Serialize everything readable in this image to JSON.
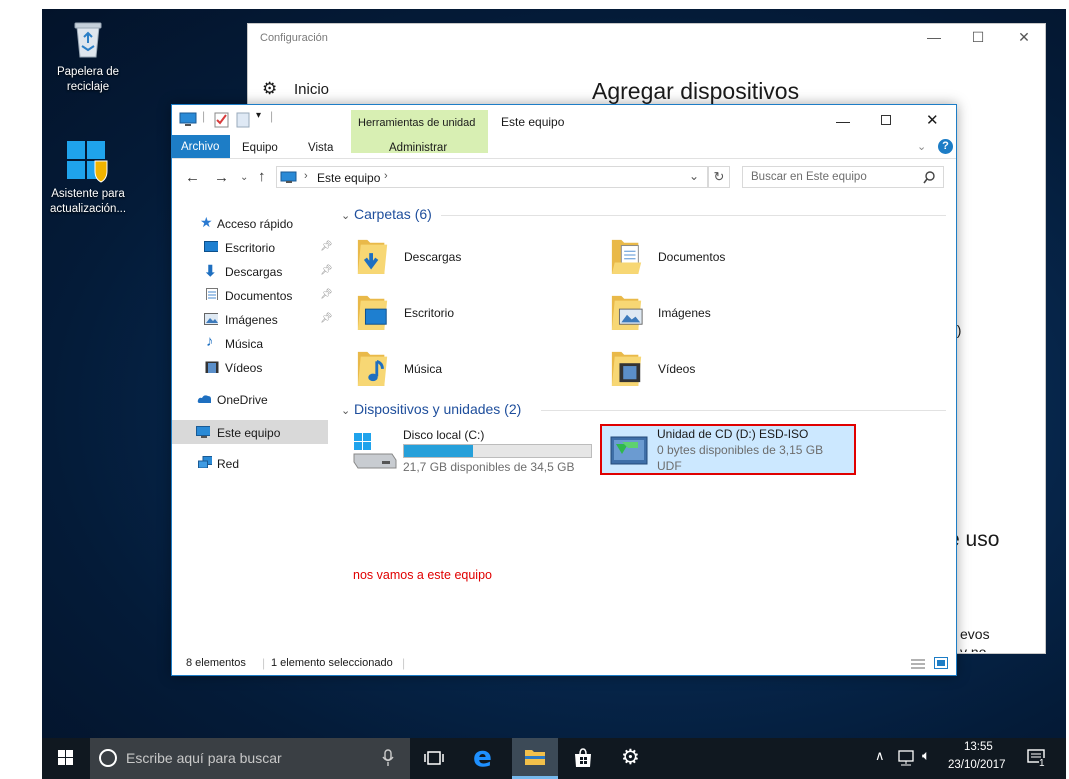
{
  "desktop": {
    "icons": [
      {
        "label_line1": "Papelera de",
        "label_line2": "reciclaje",
        "icon": "recycle-bin-icon"
      },
      {
        "label_line1": "Asistente para",
        "label_line2": "actualización...",
        "icon": "windows-update-assistant-icon"
      }
    ]
  },
  "settings_window": {
    "title": "Configuración",
    "nav_home": "Inicio",
    "heading": "Agregar dispositivos",
    "fragments": [
      ")",
      "o)",
      "e uso",
      "n",
      "evos",
      "v no"
    ],
    "controls": {
      "minimize": "—",
      "maximize": "☐",
      "close": "✕"
    }
  },
  "explorer": {
    "title": "Este equipo",
    "contextual_tab_group": "Herramientas de unidad",
    "tabs": [
      "Archivo",
      "Equipo",
      "Vista",
      "Administrar"
    ],
    "address_path": "Este equipo",
    "search_placeholder": "Buscar en Este equipo",
    "nav": {
      "quick_access": "Acceso rápido",
      "quick_items": [
        "Escritorio",
        "Descargas",
        "Documentos",
        "Imágenes",
        "Música",
        "Vídeos"
      ],
      "onedrive": "OneDrive",
      "this_pc": "Este equipo",
      "network": "Red"
    },
    "folders_section": "Carpetas (6)",
    "folders": [
      "Descargas",
      "Documentos",
      "Escritorio",
      "Imágenes",
      "Música",
      "Vídeos"
    ],
    "devices_section": "Dispositivos y unidades (2)",
    "drives": [
      {
        "name": "Disco local (C:)",
        "detail": "21,7 GB disponibles de 34,5 GB",
        "used_fraction": 0.37
      },
      {
        "name": "Unidad de CD (D:) ESD-ISO",
        "detail": "0 bytes disponibles de 3,15 GB",
        "fs": "UDF"
      }
    ],
    "annotation": "nos vamos a este equipo",
    "status_count": "8 elementos",
    "status_selected": "1 elemento seleccionado"
  },
  "taskbar": {
    "search_placeholder": "Escribe aquí para buscar",
    "time": "13:55",
    "date": "23/10/2017",
    "notification_count": "1"
  },
  "colors": {
    "accent": "#1d7dc6",
    "contextual_tab": "#d8efb3",
    "annotation": "#e00000",
    "selection_border": "#e00000",
    "selection_fill": "#cce8ff"
  }
}
